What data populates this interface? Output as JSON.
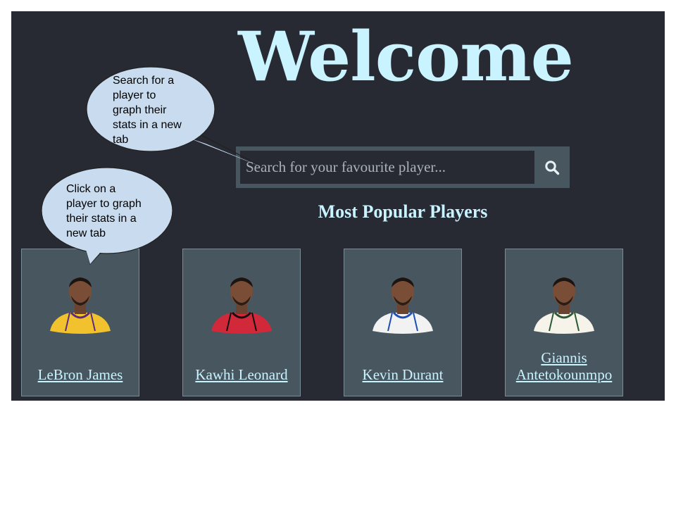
{
  "header": {
    "title": "Welcome"
  },
  "search": {
    "placeholder": "Search for your favourite player...",
    "button_icon": "search-icon"
  },
  "section": {
    "title": "Most Popular Players"
  },
  "players": [
    {
      "name": "LeBron James",
      "jersey_color": "#f2c12e",
      "trim_color": "#5b2b82"
    },
    {
      "name": "Kawhi Leonard",
      "jersey_color": "#d1293a",
      "trim_color": "#111111"
    },
    {
      "name": "Kevin Durant",
      "jersey_color": "#f2f2f2",
      "trim_color": "#1c4fb4"
    },
    {
      "name": "Giannis Antetokounmpo",
      "jersey_color": "#f5f3ea",
      "trim_color": "#2b5b34"
    }
  ],
  "annotations": {
    "search_callout": "Search for a\nplayer to\ngraph their\nstats in a new\ntab",
    "player_callout": "Click on a\nplayer to graph\ntheir stats in a\nnew tab"
  },
  "colors": {
    "background": "#272a33",
    "panel": "#47565f",
    "accent_text": "#c9f3ff",
    "callout_fill": "#c9dcef"
  }
}
